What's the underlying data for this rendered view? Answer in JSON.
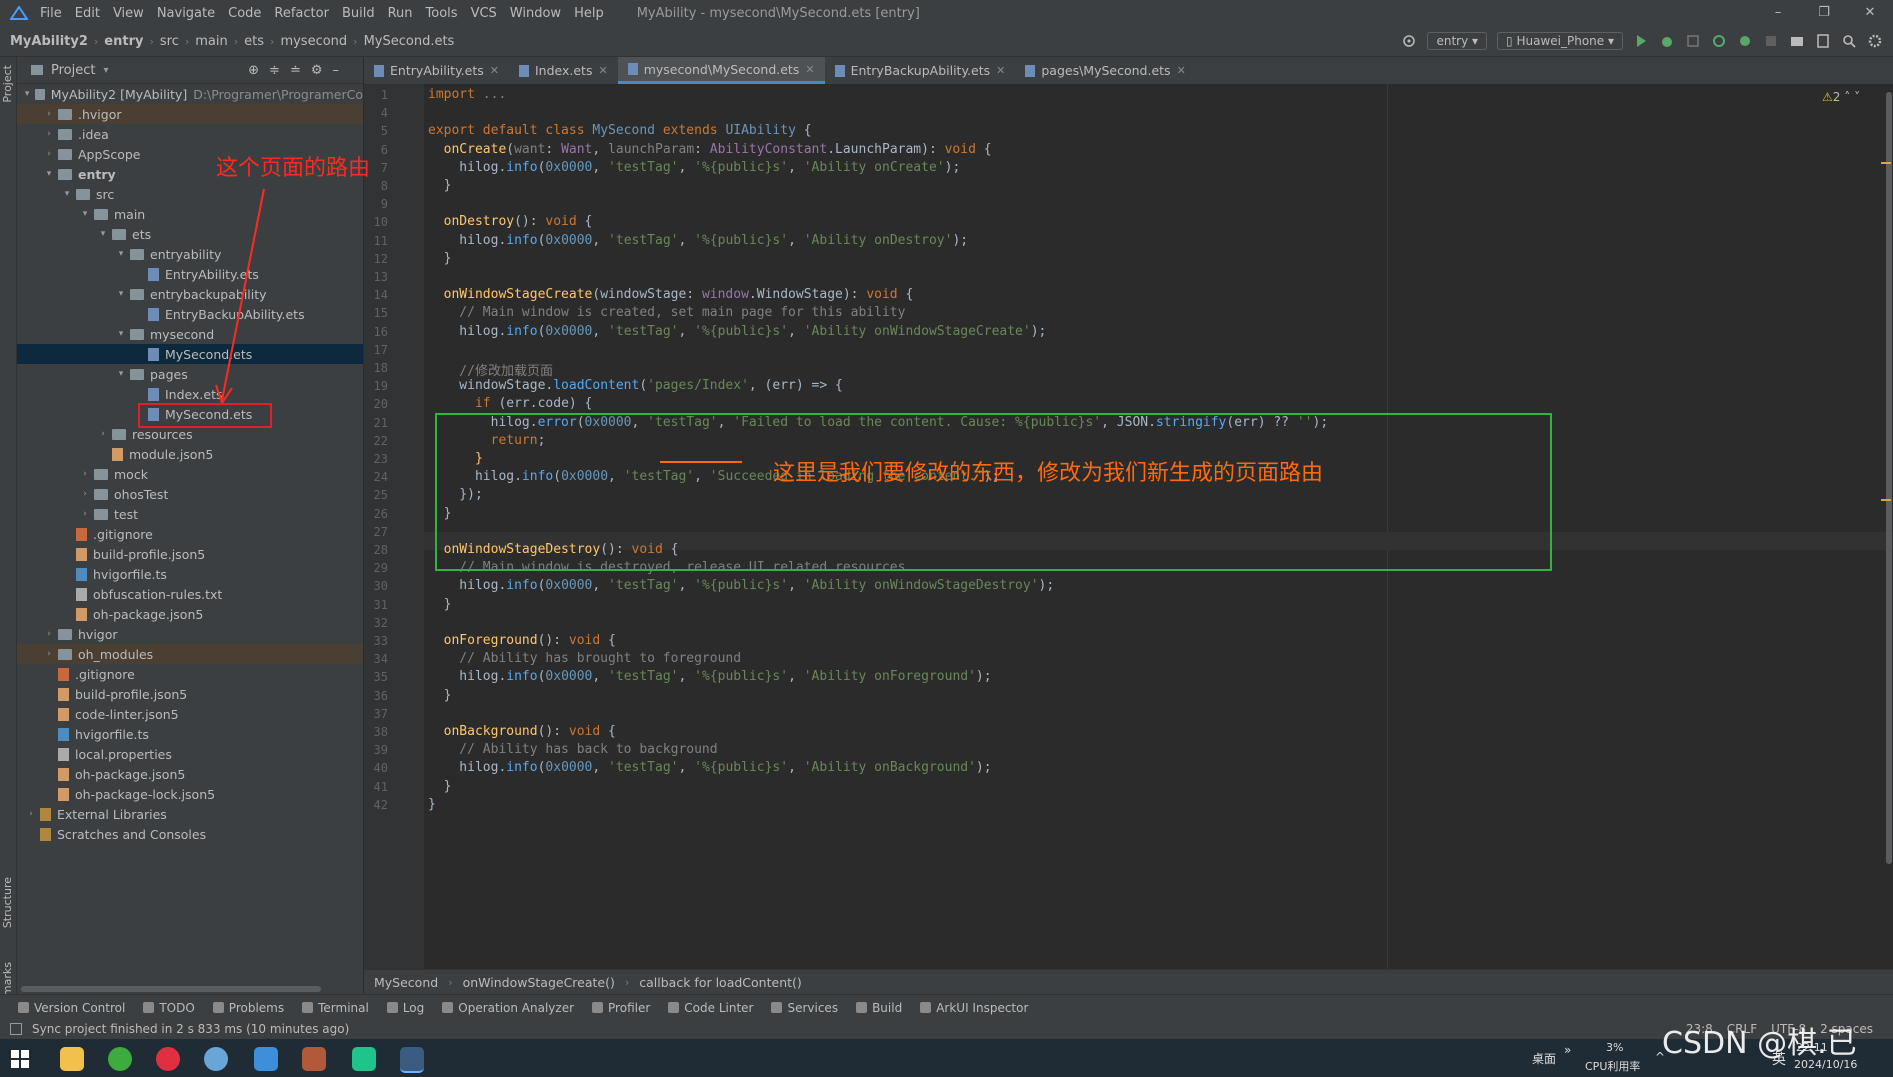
{
  "app": {
    "menu": [
      "File",
      "Edit",
      "View",
      "Navigate",
      "Code",
      "Refactor",
      "Build",
      "Run",
      "Tools",
      "VCS",
      "Window",
      "Help"
    ],
    "window_title": "MyAbility - mysecond\\MySecond.ets [entry]"
  },
  "navbar": {
    "breadcrumbs": [
      "MyAbility2",
      "entry",
      "src",
      "main",
      "ets",
      "mysecond",
      "MySecond.ets"
    ],
    "run_config": "entry",
    "device": "Huawei_Phone"
  },
  "sidebar_strip": {
    "project_label": "Project",
    "structure_label": "Structure",
    "bookmarks_label": "Bookmarks"
  },
  "project": {
    "title": "Project",
    "tree": [
      {
        "label": "MyAbility2 [MyAbility]",
        "path": "D:\\Programer\\ProgramerCo",
        "depth": 0,
        "kind": "module",
        "open": true,
        "bold": false
      },
      {
        "label": ".hvigor",
        "depth": 1,
        "kind": "folder",
        "open": false,
        "style": "ex"
      },
      {
        "label": ".idea",
        "depth": 1,
        "kind": "folder",
        "open": false
      },
      {
        "label": "AppScope",
        "depth": 1,
        "kind": "folder",
        "open": false
      },
      {
        "label": "entry",
        "depth": 1,
        "kind": "folder",
        "open": true,
        "bold": true
      },
      {
        "label": "src",
        "depth": 2,
        "kind": "folder",
        "open": true
      },
      {
        "label": "main",
        "depth": 3,
        "kind": "folder",
        "open": true
      },
      {
        "label": "ets",
        "depth": 4,
        "kind": "folder",
        "open": true
      },
      {
        "label": "entryability",
        "depth": 5,
        "kind": "folder",
        "open": true
      },
      {
        "label": "EntryAbility.ets",
        "depth": 6,
        "kind": "file"
      },
      {
        "label": "entrybackupability",
        "depth": 5,
        "kind": "folder",
        "open": true
      },
      {
        "label": "EntryBackupAbility.ets",
        "depth": 6,
        "kind": "file"
      },
      {
        "label": "mysecond",
        "depth": 5,
        "kind": "folder",
        "open": true
      },
      {
        "label": "MySecond.ets",
        "depth": 6,
        "kind": "file",
        "style": "sel"
      },
      {
        "label": "pages",
        "depth": 5,
        "kind": "folder",
        "open": true
      },
      {
        "label": "Index.ets",
        "depth": 6,
        "kind": "file"
      },
      {
        "label": "MySecond.ets",
        "depth": 6,
        "kind": "file"
      },
      {
        "label": "resources",
        "depth": 4,
        "kind": "folder",
        "open": false
      },
      {
        "label": "module.json5",
        "depth": 4,
        "kind": "json"
      },
      {
        "label": "mock",
        "depth": 3,
        "kind": "folder",
        "open": false
      },
      {
        "label": "ohosTest",
        "depth": 3,
        "kind": "folder",
        "open": false
      },
      {
        "label": "test",
        "depth": 3,
        "kind": "folder",
        "open": false
      },
      {
        "label": ".gitignore",
        "depth": 2,
        "kind": "git"
      },
      {
        "label": "build-profile.json5",
        "depth": 2,
        "kind": "json"
      },
      {
        "label": "hvigorfile.ts",
        "depth": 2,
        "kind": "ts"
      },
      {
        "label": "obfuscation-rules.txt",
        "depth": 2,
        "kind": "txt"
      },
      {
        "label": "oh-package.json5",
        "depth": 2,
        "kind": "json"
      },
      {
        "label": "hvigor",
        "depth": 1,
        "kind": "folder",
        "open": false
      },
      {
        "label": "oh_modules",
        "depth": 1,
        "kind": "folder",
        "open": false,
        "style": "ex"
      },
      {
        "label": ".gitignore",
        "depth": 1,
        "kind": "git"
      },
      {
        "label": "build-profile.json5",
        "depth": 1,
        "kind": "json"
      },
      {
        "label": "code-linter.json5",
        "depth": 1,
        "kind": "json"
      },
      {
        "label": "hvigorfile.ts",
        "depth": 1,
        "kind": "ts"
      },
      {
        "label": "local.properties",
        "depth": 1,
        "kind": "txt"
      },
      {
        "label": "oh-package.json5",
        "depth": 1,
        "kind": "json"
      },
      {
        "label": "oh-package-lock.json5",
        "depth": 1,
        "kind": "json"
      },
      {
        "label": "External Libraries",
        "depth": 0,
        "kind": "lib",
        "open": false
      },
      {
        "label": "Scratches and Consoles",
        "depth": 0,
        "kind": "lib"
      }
    ]
  },
  "editor": {
    "tabs": [
      {
        "label": "EntryAbility.ets",
        "active": false
      },
      {
        "label": "Index.ets",
        "active": false
      },
      {
        "label": "mysecond\\MySecond.ets",
        "active": true
      },
      {
        "label": "EntryBackupAbility.ets",
        "active": false
      },
      {
        "label": "pages\\MySecond.ets",
        "active": false
      }
    ],
    "warnings": "2",
    "line_numbers": [
      "1",
      "4",
      "5",
      "6",
      "7",
      "8",
      "9",
      "10",
      "11",
      "12",
      "13",
      "14",
      "15",
      "16",
      "17",
      "18",
      "19",
      "20",
      "21",
      "22",
      "23",
      "24",
      "25",
      "26",
      "27",
      "28",
      "29",
      "30",
      "31",
      "32",
      "33",
      "34",
      "35",
      "36",
      "37",
      "38",
      "39",
      "40",
      "41",
      "42"
    ],
    "breadcrumbs": [
      "MySecond",
      "onWindowStageCreate()",
      "callback for loadContent()"
    ]
  },
  "code_lines": [
    [
      [
        "kw",
        "import "
      ],
      [
        "cm",
        "..."
      ]
    ],
    [
      [
        "",
        ""
      ]
    ],
    [
      [
        "kw",
        "export default class "
      ],
      [
        "cl",
        "MySecond "
      ],
      [
        "kw",
        "extends "
      ],
      [
        "cl",
        "UIAbility "
      ],
      [
        "",
        "{"
      ]
    ],
    [
      [
        "fn",
        "  onCreate"
      ],
      [
        "",
        "("
      ],
      [
        "cm",
        "want"
      ],
      [
        "",
        ": "
      ],
      [
        "ty",
        "Want"
      ],
      [
        "",
        ", "
      ],
      [
        "cm",
        "launchParam"
      ],
      [
        "",
        ": "
      ],
      [
        "ty",
        "AbilityConstant"
      ],
      [
        "",
        ".LaunchParam): "
      ],
      [
        "kw",
        "void "
      ],
      [
        "",
        "{"
      ]
    ],
    [
      [
        "",
        "    hilog."
      ],
      [
        "ent",
        "info"
      ],
      [
        "",
        "("
      ],
      [
        "num",
        "0x0000"
      ],
      [
        "",
        ", "
      ],
      [
        "str",
        "'testTag'"
      ],
      [
        "",
        ", "
      ],
      [
        "str",
        "'%{public}s'"
      ],
      [
        "",
        ", "
      ],
      [
        "str",
        "'Ability onCreate'"
      ],
      [
        "",
        ");"
      ]
    ],
    [
      [
        "",
        "  }"
      ]
    ],
    [
      [
        "",
        ""
      ]
    ],
    [
      [
        "fn",
        "  onDestroy"
      ],
      [
        "",
        "(): "
      ],
      [
        "kw",
        "void "
      ],
      [
        "",
        "{"
      ]
    ],
    [
      [
        "",
        "    hilog."
      ],
      [
        "ent",
        "info"
      ],
      [
        "",
        "("
      ],
      [
        "num",
        "0x0000"
      ],
      [
        "",
        ", "
      ],
      [
        "str",
        "'testTag'"
      ],
      [
        "",
        ", "
      ],
      [
        "str",
        "'%{public}s'"
      ],
      [
        "",
        ", "
      ],
      [
        "str",
        "'Ability onDestroy'"
      ],
      [
        "",
        ");"
      ]
    ],
    [
      [
        "",
        "  }"
      ]
    ],
    [
      [
        "",
        ""
      ]
    ],
    [
      [
        "fn",
        "  onWindowStageCreate"
      ],
      [
        "",
        "(windowStage: "
      ],
      [
        "ty",
        "window"
      ],
      [
        "",
        ".WindowStage): "
      ],
      [
        "kw",
        "void "
      ],
      [
        "",
        "{"
      ]
    ],
    [
      [
        "cm",
        "    // Main window is created, set main page for this ability"
      ]
    ],
    [
      [
        "",
        "    hilog."
      ],
      [
        "ent",
        "info"
      ],
      [
        "",
        "("
      ],
      [
        "num",
        "0x0000"
      ],
      [
        "",
        ", "
      ],
      [
        "str",
        "'testTag'"
      ],
      [
        "",
        ", "
      ],
      [
        "str",
        "'%{public}s'"
      ],
      [
        "",
        ", "
      ],
      [
        "str",
        "'Ability onWindowStageCreate'"
      ],
      [
        "",
        ");"
      ]
    ],
    [
      [
        "",
        ""
      ]
    ],
    [
      [
        "cm",
        "    //修改加载页面"
      ]
    ],
    [
      [
        "",
        "    windowStage."
      ],
      [
        "ent",
        "loadContent"
      ],
      [
        "",
        "("
      ],
      [
        "str",
        "'pages/Index'"
      ],
      [
        "",
        ", (err) => {"
      ]
    ],
    [
      [
        "kw",
        "      if "
      ],
      [
        "",
        "(err.code) {"
      ]
    ],
    [
      [
        "",
        "        hilog."
      ],
      [
        "ent",
        "error"
      ],
      [
        "",
        "("
      ],
      [
        "num",
        "0x0000"
      ],
      [
        "",
        ", "
      ],
      [
        "str",
        "'testTag'"
      ],
      [
        "",
        ", "
      ],
      [
        "str",
        "'Failed to load the content. Cause: %{public}s'"
      ],
      [
        "",
        ", JSON."
      ],
      [
        "ent",
        "stringify"
      ],
      [
        "",
        "(err) ?? "
      ],
      [
        "str",
        "''"
      ],
      [
        "",
        ");"
      ]
    ],
    [
      [
        "kw",
        "        return"
      ],
      [
        "",
        ";"
      ]
    ],
    [
      [
        "mid",
        "      }"
      ]
    ],
    [
      [
        "",
        "      hilog."
      ],
      [
        "ent",
        "info"
      ],
      [
        "",
        "("
      ],
      [
        "num",
        "0x0000"
      ],
      [
        "",
        ", "
      ],
      [
        "str",
        "'testTag'"
      ],
      [
        "",
        ", "
      ],
      [
        "str",
        "'Succeeded in loading the content.'"
      ],
      [
        "",
        ");"
      ]
    ],
    [
      [
        "",
        "    });"
      ]
    ],
    [
      [
        "",
        "  }"
      ]
    ],
    [
      [
        "",
        ""
      ]
    ],
    [
      [
        "fn",
        "  onWindowStageDestroy"
      ],
      [
        "",
        "(): "
      ],
      [
        "kw",
        "void "
      ],
      [
        "",
        "{"
      ]
    ],
    [
      [
        "cm",
        "    // Main window is destroyed, release UI related resources"
      ]
    ],
    [
      [
        "",
        "    hilog."
      ],
      [
        "ent",
        "info"
      ],
      [
        "",
        "("
      ],
      [
        "num",
        "0x0000"
      ],
      [
        "",
        ", "
      ],
      [
        "str",
        "'testTag'"
      ],
      [
        "",
        ", "
      ],
      [
        "str",
        "'%{public}s'"
      ],
      [
        "",
        ", "
      ],
      [
        "str",
        "'Ability onWindowStageDestroy'"
      ],
      [
        "",
        ");"
      ]
    ],
    [
      [
        "",
        "  }"
      ]
    ],
    [
      [
        "",
        ""
      ]
    ],
    [
      [
        "fn",
        "  onForeground"
      ],
      [
        "",
        "(): "
      ],
      [
        "kw",
        "void "
      ],
      [
        "",
        "{"
      ]
    ],
    [
      [
        "cm",
        "    // Ability has brought to foreground"
      ]
    ],
    [
      [
        "",
        "    hilog."
      ],
      [
        "ent",
        "info"
      ],
      [
        "",
        "("
      ],
      [
        "num",
        "0x0000"
      ],
      [
        "",
        ", "
      ],
      [
        "str",
        "'testTag'"
      ],
      [
        "",
        ", "
      ],
      [
        "str",
        "'%{public}s'"
      ],
      [
        "",
        ", "
      ],
      [
        "str",
        "'Ability onForeground'"
      ],
      [
        "",
        ");"
      ]
    ],
    [
      [
        "",
        "  }"
      ]
    ],
    [
      [
        "",
        ""
      ]
    ],
    [
      [
        "fn",
        "  onBackground"
      ],
      [
        "",
        "(): "
      ],
      [
        "kw",
        "void "
      ],
      [
        "",
        "{"
      ]
    ],
    [
      [
        "cm",
        "    // Ability has back to background"
      ]
    ],
    [
      [
        "",
        "    hilog."
      ],
      [
        "ent",
        "info"
      ],
      [
        "",
        "("
      ],
      [
        "num",
        "0x0000"
      ],
      [
        "",
        ", "
      ],
      [
        "str",
        "'testTag'"
      ],
      [
        "",
        ", "
      ],
      [
        "str",
        "'%{public}s'"
      ],
      [
        "",
        ", "
      ],
      [
        "str",
        "'Ability onBackground'"
      ],
      [
        "",
        ");"
      ]
    ],
    [
      [
        "",
        "  }"
      ]
    ],
    [
      [
        "",
        "}"
      ]
    ]
  ],
  "annotations": {
    "route_label": "这个页面的路由",
    "change_label": "这里是我们要修改的东西，修改为我们新生成的页面路由"
  },
  "tool_windows": [
    "Version Control",
    "TODO",
    "Problems",
    "Terminal",
    "Log",
    "Operation Analyzer",
    "Profiler",
    "Code Linter",
    "Services",
    "Build",
    "ArkUI Inspector"
  ],
  "status": {
    "message": "Sync project finished in 2 s 833 ms (10 minutes ago)",
    "position": "23:8",
    "line_sep": "CRLF",
    "encoding": "UTF-8",
    "indent": "2 spaces"
  },
  "taskbar": {
    "desktop_label": "桌面",
    "cpu_percent": "3%",
    "cpu_label": "CPU利用率",
    "ime": "英",
    "time": "22:11",
    "date": "2024/10/16"
  },
  "watermark": "CSDN @棋.已",
  "colors": {
    "accent": "#4a88c7",
    "annotation_red": "#ff2a1f",
    "annotation_green": "#2fb53c",
    "annotation_orange": "#ff6a10"
  }
}
